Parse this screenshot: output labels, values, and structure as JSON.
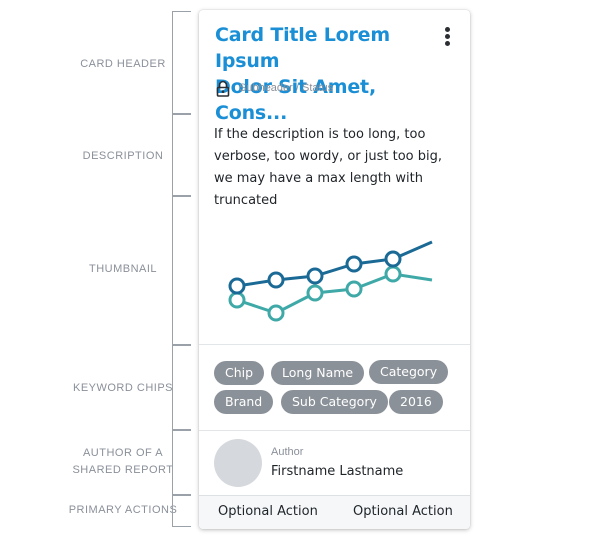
{
  "annotations": {
    "card_header": "CARD HEADER",
    "description": "DESCRIPTION",
    "thumbnail": "THUMBNAIL",
    "keyword_chips": "KEYWORD CHIPS",
    "author_line1": "AUTHOR OF A",
    "author_line2": "SHARED REPORT",
    "primary_actions": "PRIMARY ACTIONS"
  },
  "card": {
    "title_line1": "Card Title Lorem Ipsum",
    "title_line2": "Dolor Sit Amet, Cons...",
    "subheader": "Subheader / Status",
    "description": "If the description is too long, too verbose, too wordy, or just too big, we may have a max length with truncated",
    "chips": [
      "Chip",
      "Long Name",
      "Category",
      "Brand",
      "Sub Category",
      "2016"
    ],
    "author_label": "Author",
    "author_name": "Firstname Lastname",
    "actions": [
      "Optional Action",
      "Optional Action"
    ]
  },
  "colors": {
    "title": "#1a8fd6",
    "series_dark": "#1b6a96",
    "series_teal": "#3fa9a8",
    "chip_bg": "#8a9198",
    "annotation_text": "#8a9099"
  },
  "icons": {
    "more": "more-vert-icon",
    "lock": "lock-icon"
  }
}
